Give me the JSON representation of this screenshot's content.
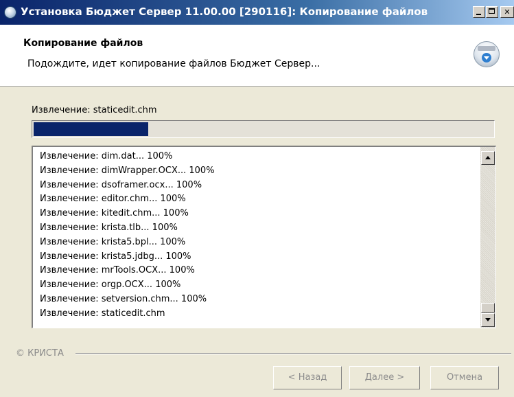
{
  "window": {
    "title": "Установка Бюджет Сервер 11.00.00 [290116]: Копирование файлов"
  },
  "header": {
    "title": "Копирование файлов",
    "subtitle": "Подождите, идет копирование файлов Бюджет Сервер..."
  },
  "status": {
    "label": "Извлечение: staticedit.chm",
    "progress_fraction": 0.25
  },
  "log": {
    "lines": [
      "Извлечение: dim.dat... 100%",
      "Извлечение: dimWrapper.OCX... 100%",
      "Извлечение: dsoframer.ocx... 100%",
      "Извлечение: editor.chm... 100%",
      "Извлечение: kitedit.chm... 100%",
      "Извлечение: krista.tlb... 100%",
      "Извлечение: krista5.bpl... 100%",
      "Извлечение: krista5.jdbg... 100%",
      "Извлечение: mrTools.OCX... 100%",
      "Извлечение: orgp.OCX... 100%",
      "Извлечение: setversion.chm... 100%",
      "Извлечение: staticedit.chm"
    ]
  },
  "footer": {
    "brand": "© КРИСТА",
    "buttons": {
      "back": "< Назад",
      "next": "Далее >",
      "cancel": "Отмена"
    }
  },
  "icons": {
    "title": "installer-disc-icon",
    "header": "install-download-icon"
  },
  "colors": {
    "progress": "#0a246a",
    "titlebar": "#0a246a"
  }
}
